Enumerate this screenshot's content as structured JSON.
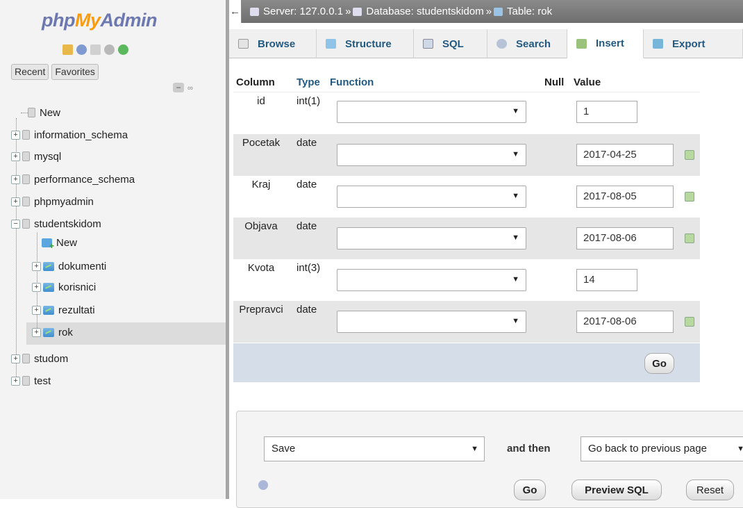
{
  "nav": {
    "logo_part1": "php",
    "logo_part2": "My",
    "logo_part3": "Admin",
    "tab_recent": "Recent",
    "tab_favorites": "Favorites",
    "tree": {
      "new": "New",
      "information_schema": "information_schema",
      "mysql": "mysql",
      "performance_schema": "performance_schema",
      "phpmyadmin": "phpmyadmin",
      "studentskidom": "studentskidom",
      "sd_new": "New",
      "dokumenti": "dokumenti",
      "korisnici": "korisnici",
      "rezultati": "rezultati",
      "rok": "rok",
      "studom": "studom",
      "test": "test"
    }
  },
  "breadcrumb": {
    "server": "Server: 127.0.0.1",
    "database": "Database: studentskidom",
    "table": "Table: rok",
    "sep": "»"
  },
  "tabs": {
    "browse": "Browse",
    "structure": "Structure",
    "sql": "SQL",
    "search": "Search",
    "insert": "Insert",
    "export": "Export"
  },
  "form": {
    "headers": {
      "column": "Column",
      "type": "Type",
      "function": "Function",
      "null": "Null",
      "value": "Value"
    },
    "rows": [
      {
        "column": "id",
        "type": "int(1)",
        "value": "1"
      },
      {
        "column": "Pocetak",
        "type": "date",
        "value": "2017-04-25"
      },
      {
        "column": "Kraj",
        "type": "date",
        "value": "2017-08-05"
      },
      {
        "column": "Objava",
        "type": "date",
        "value": "2017-08-06"
      },
      {
        "column": "Kvota",
        "type": "int(3)",
        "value": "14"
      },
      {
        "column": "Prepravci",
        "type": "date",
        "value": "2017-08-06"
      }
    ],
    "go_label": "Go"
  },
  "footer": {
    "save_select": "Save",
    "and_then": "and then",
    "after_select": "Go back to previous page",
    "go_label": "Go",
    "preview_label": "Preview SQL",
    "reset_label": "Reset"
  },
  "colors": {
    "tab_text": "#235a81",
    "logo_blue": "#6c78af",
    "logo_orange": "#f89c0e",
    "alt_row": "#e6e6e6",
    "go_row": "#d5dde8"
  }
}
